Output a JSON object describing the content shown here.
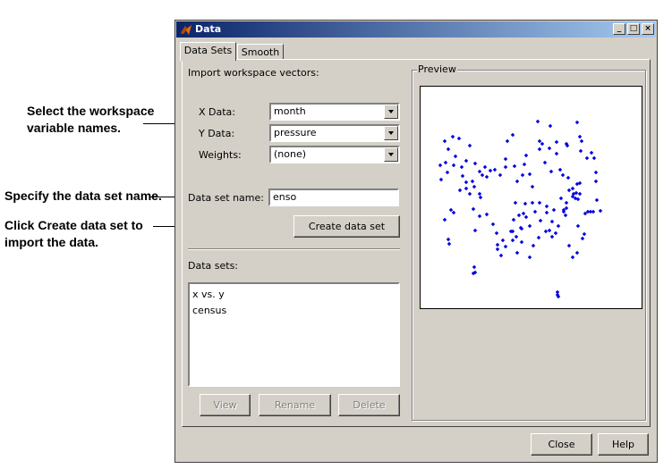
{
  "annotations": {
    "select_line1": "Select the workspace",
    "select_line2": "variable names.",
    "specify": "Specify the data set name.",
    "click_line1_prefix": "Click ",
    "click_line1_bold": "Create data set",
    "click_line1_suffix": " to",
    "click_line2": "import the data."
  },
  "window": {
    "title": "Data",
    "icon": "matlab-icon",
    "controls": [
      "minimize-icon",
      "maximize-icon",
      "close-icon"
    ]
  },
  "tabs": [
    {
      "label": "Data Sets",
      "active": true
    },
    {
      "label": "Smooth",
      "active": false
    }
  ],
  "import": {
    "heading": "Import workspace vectors:",
    "x_label": "X Data:",
    "x_value": "month",
    "y_label": "Y Data:",
    "y_value": "pressure",
    "w_label": "Weights:",
    "w_value": "(none)",
    "name_label": "Data set name:",
    "name_value": "enso",
    "create_button": "Create data set"
  },
  "datasets": {
    "heading": "Data sets:",
    "items": [
      "x vs. y",
      "census"
    ],
    "view_button": "View",
    "rename_button": "Rename",
    "delete_button": "Delete"
  },
  "preview": {
    "label": "Preview",
    "marker_color": "#0000e0"
  },
  "footer": {
    "close_button": "Close",
    "help_button": "Help"
  },
  "chart_data": {
    "type": "scatter",
    "points": [
      [
        27,
        61
      ],
      [
        31,
        70
      ],
      [
        28,
        85
      ],
      [
        22,
        88
      ],
      [
        23,
        104
      ],
      [
        30,
        96
      ],
      [
        36,
        56
      ],
      [
        43,
        58
      ],
      [
        51,
        83
      ],
      [
        51,
        107
      ],
      [
        44,
        116
      ],
      [
        37,
        88
      ],
      [
        39,
        78
      ],
      [
        46,
        90
      ],
      [
        47,
        100
      ],
      [
        51,
        114
      ],
      [
        58,
        106
      ],
      [
        60,
        112
      ],
      [
        61,
        86
      ],
      [
        66,
        95
      ],
      [
        66,
        120
      ],
      [
        69,
        99
      ],
      [
        67,
        124
      ],
      [
        72,
        90
      ],
      [
        78,
        94
      ],
      [
        74,
        101
      ],
      [
        83,
        93
      ],
      [
        89,
        99
      ],
      [
        95,
        90
      ],
      [
        95,
        81
      ],
      [
        97,
        61
      ],
      [
        103,
        54
      ],
      [
        105,
        89
      ],
      [
        108,
        106
      ],
      [
        114,
        99
      ],
      [
        116,
        87
      ],
      [
        118,
        77
      ],
      [
        122,
        98
      ],
      [
        125,
        112
      ],
      [
        131,
        39
      ],
      [
        133,
        61
      ],
      [
        133,
        70
      ],
      [
        136,
        64
      ],
      [
        139,
        85
      ],
      [
        144,
        69
      ],
      [
        146,
        95
      ],
      [
        152,
        62
      ],
      [
        152,
        75
      ],
      [
        156,
        93
      ],
      [
        159,
        99
      ],
      [
        165,
        102
      ],
      [
        170,
        114
      ],
      [
        175,
        109
      ],
      [
        178,
        108
      ],
      [
        186,
        80
      ],
      [
        191,
        74
      ],
      [
        194,
        80
      ],
      [
        196,
        96
      ],
      [
        196,
        106
      ],
      [
        197,
        127
      ],
      [
        201,
        139
      ],
      [
        175,
        40
      ],
      [
        178,
        56
      ],
      [
        180,
        61
      ],
      [
        179,
        72
      ],
      [
        145,
        44
      ],
      [
        141,
        141
      ],
      [
        95,
        179
      ],
      [
        90,
        189
      ],
      [
        85,
        164
      ],
      [
        103,
        162
      ],
      [
        104,
        149
      ],
      [
        110,
        144
      ],
      [
        117,
        131
      ],
      [
        125,
        130
      ],
      [
        133,
        130
      ],
      [
        128,
        140
      ],
      [
        118,
        146
      ],
      [
        112,
        158
      ],
      [
        103,
        172
      ],
      [
        108,
        186
      ],
      [
        122,
        156
      ],
      [
        140,
        162
      ],
      [
        147,
        168
      ],
      [
        151,
        164
      ],
      [
        154,
        156
      ],
      [
        166,
        178
      ],
      [
        175,
        186
      ],
      [
        170,
        191
      ],
      [
        27,
        149
      ],
      [
        34,
        138
      ],
      [
        37,
        141
      ],
      [
        31,
        171
      ],
      [
        32,
        176
      ],
      [
        55,
        120
      ],
      [
        59,
        137
      ],
      [
        61,
        161
      ],
      [
        66,
        145
      ],
      [
        74,
        143
      ],
      [
        81,
        154
      ],
      [
        86,
        182
      ],
      [
        86,
        177
      ],
      [
        92,
        172
      ],
      [
        101,
        162
      ],
      [
        107,
        168
      ],
      [
        113,
        159
      ],
      [
        113,
        174
      ],
      [
        122,
        191
      ],
      [
        126,
        178
      ],
      [
        132,
        169
      ],
      [
        134,
        150
      ],
      [
        141,
        134
      ],
      [
        144,
        161
      ],
      [
        147,
        151
      ],
      [
        149,
        138
      ],
      [
        160,
        138
      ],
      [
        162,
        144
      ],
      [
        163,
        136
      ],
      [
        157,
        125
      ],
      [
        163,
        130
      ],
      [
        171,
        120
      ],
      [
        178,
        120
      ],
      [
        184,
        142
      ],
      [
        187,
        140
      ],
      [
        190,
        140
      ],
      [
        193,
        140
      ],
      [
        181,
        170
      ],
      [
        183,
        165
      ],
      [
        176,
        156
      ],
      [
        60,
        202
      ],
      [
        59,
        209
      ],
      [
        61,
        208
      ],
      [
        153,
        230
      ],
      [
        153,
        233
      ],
      [
        154,
        235
      ],
      [
        166,
        116
      ],
      [
        170,
        123
      ],
      [
        173,
        125
      ],
      [
        174,
        119
      ],
      [
        176,
        126
      ],
      [
        163,
        64
      ],
      [
        164,
        66
      ],
      [
        160,
        140
      ],
      [
        115,
        142
      ],
      [
        106,
        130
      ],
      [
        55,
        66
      ]
    ]
  }
}
